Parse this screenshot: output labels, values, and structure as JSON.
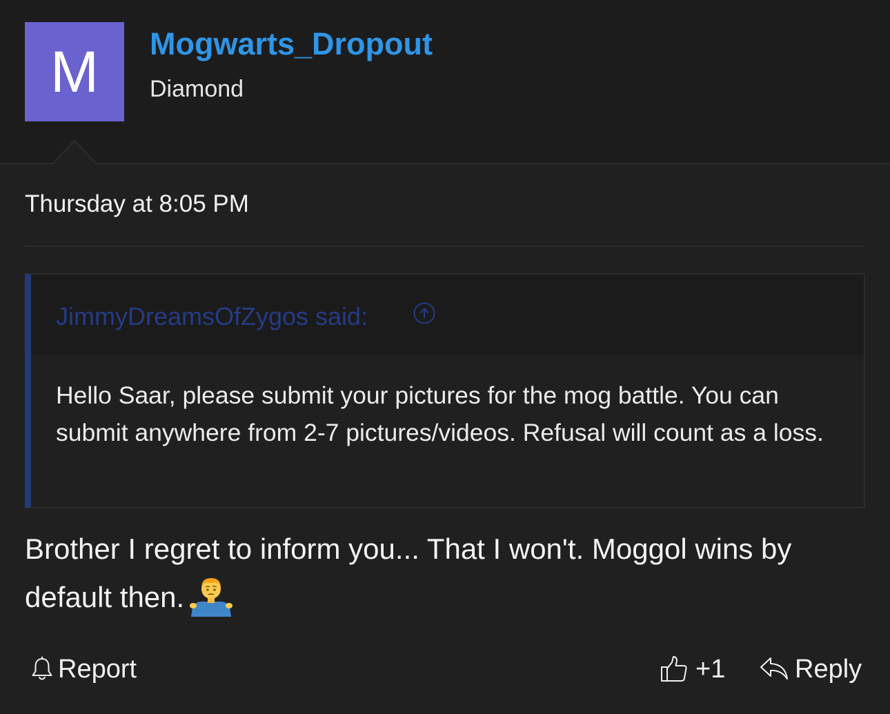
{
  "user": {
    "avatar_letter": "M",
    "avatar_color": "#6a62cf",
    "username": "Mogwarts_Dropout",
    "username_color": "#2f95e6",
    "title": "Diamond"
  },
  "post": {
    "timestamp": "Thursday at 8:05 PM",
    "quote": {
      "author_line": "JimmyDreamsOfZygos said:",
      "jump_icon": "arrow-up-circle-icon",
      "body": "Hello Saar, please submit your pictures for the mog battle. You can submit anywhere from 2-7 pictures/videos. Refusal will count as a loss."
    },
    "message": "Brother I regret to inform you... That I won't. Moggol wins by default then.",
    "message_emoji": "person-shrugging-emoji"
  },
  "actions": {
    "report_label": "Report",
    "report_icon": "bell-icon",
    "like_count": "+1",
    "like_icon": "thumbs-up-icon",
    "reply_label": "Reply",
    "reply_icon": "reply-arrow-icon"
  }
}
